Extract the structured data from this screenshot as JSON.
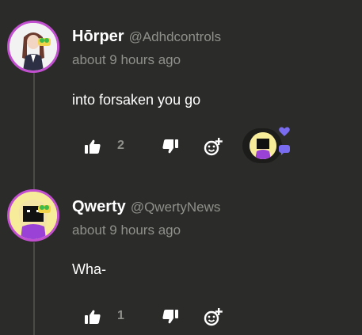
{
  "comments": [
    {
      "author": "Hōrper",
      "handle": "@Adhdcontrols",
      "time": "about 9 hours ago",
      "text": "into forsaken you go",
      "likes": "2",
      "icons": {
        "like": "thumbs-up-icon",
        "dislike": "thumbs-down-icon",
        "react": "add-reaction-icon"
      },
      "reaction_popover": {
        "icons": [
          "heart-icon",
          "chat-bubble-icon"
        ]
      }
    },
    {
      "author": "Qwerty",
      "handle": "@QwertyNews",
      "time": "about 9 hours ago",
      "text": "Wha-",
      "likes": "1",
      "icons": {
        "like": "thumbs-up-icon",
        "dislike": "thumbs-down-icon",
        "react": "add-reaction-icon"
      }
    }
  ],
  "colors": {
    "background": "#2b2b29",
    "avatar_ring": "#c24fd0",
    "muted_text": "#8f8f8b",
    "icon": "#ffffff",
    "reaction_accent": "#7a6cf0"
  }
}
